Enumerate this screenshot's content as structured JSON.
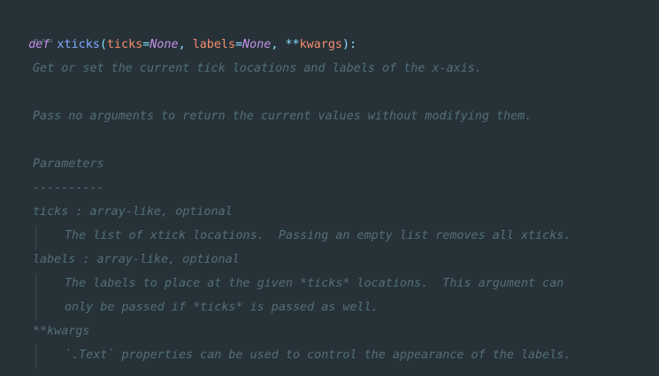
{
  "code": {
    "def_keyword": "def",
    "function_name": "xticks",
    "open_paren": "(",
    "param1_name": "ticks",
    "equals1": "=",
    "param1_default": "None",
    "comma1": ",",
    "param2_name": "labels",
    "equals2": "=",
    "param2_default": "None",
    "comma2": ",",
    "kwargs_stars": "**",
    "kwargs_name": "kwargs",
    "close_sig": "):"
  },
  "docstring": {
    "open_quotes": "\"\"\"",
    "summary": "Get or set the current tick locations and labels of the x-axis.",
    "description": "Pass no arguments to return the current values without modifying them.",
    "parameters_heading": "Parameters",
    "parameters_underline": "----------",
    "ticks_signature": "ticks : array-like, optional",
    "ticks_description": "The list of xtick locations.  Passing an empty list removes all xticks.",
    "labels_signature": "labels : array-like, optional",
    "labels_description_1": "The labels to place at the given *ticks* locations.  This argument can",
    "labels_description_2": "only be passed if *ticks* is passed as well.",
    "kwargs_signature": "**kwargs",
    "kwargs_description": "`.Text` properties can be used to control the appearance of the labels."
  },
  "colors": {
    "background": "#263238",
    "keyword": "#c792ea",
    "function": "#82aaff",
    "punctuation": "#89ddff",
    "parameter": "#f78c6c",
    "comment": "#546e7a"
  }
}
